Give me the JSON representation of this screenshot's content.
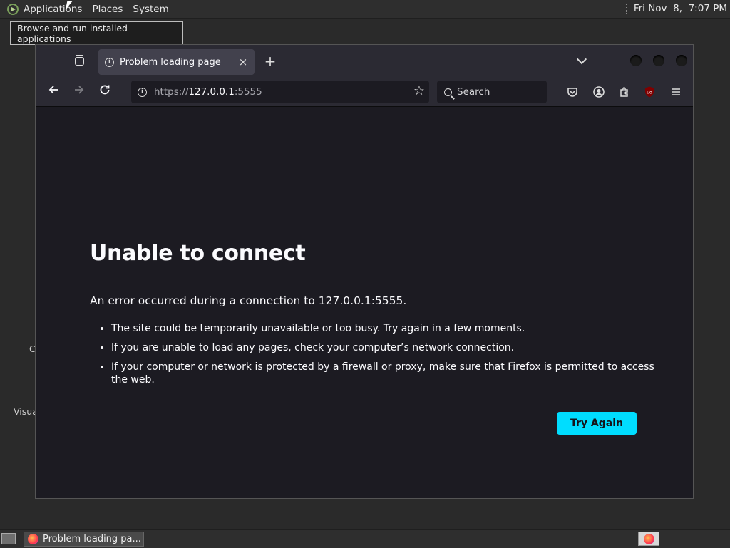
{
  "top_panel": {
    "menus": [
      "Applications",
      "Places",
      "System"
    ],
    "clock": "Fri Nov  8,  7:07 PM"
  },
  "tooltip": "Browse and run installed applications",
  "desktop_labels": [
    "C",
    "Visua"
  ],
  "browser": {
    "tab": {
      "title": "Problem loading page",
      "close": "×"
    },
    "new_tab": "+",
    "url": {
      "scheme": "https://",
      "host": "127.0.0.1",
      "port": ":5555"
    },
    "search_placeholder": "Search"
  },
  "error_page": {
    "title": "Unable to connect",
    "intro": "An error occurred during a connection to 127.0.0.1:5555.",
    "items": [
      "The site could be temporarily unavailable or too busy. Try again in a few moments.",
      "If you are unable to load any pages, check your computer’s network connection.",
      "If your computer or network is protected by a firewall or proxy, make sure that Firefox is permitted to access the web."
    ],
    "button": "Try Again"
  },
  "taskbar": {
    "window_title": "Problem loading pa..."
  },
  "colors": {
    "accent_button": "#00ddff",
    "content_bg": "#1c1b22",
    "toolbar_bg": "#2b2a33"
  }
}
